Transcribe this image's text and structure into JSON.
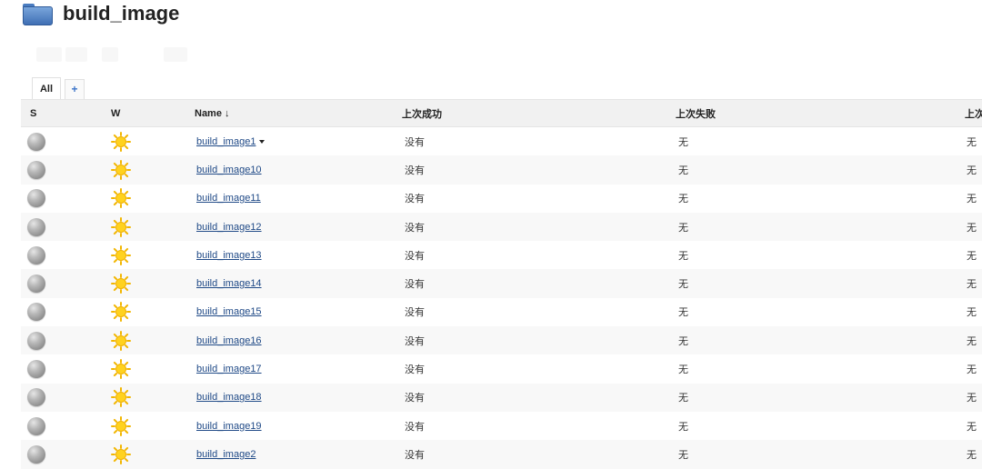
{
  "page": {
    "title": "build_image"
  },
  "tabs": {
    "all_label": "All",
    "add_label": "+"
  },
  "table": {
    "headers": {
      "status": "S",
      "weather": "W",
      "name": "Name ↓",
      "last_success": "上次成功",
      "last_failure": "上次失败",
      "last_duration": "上次持续时"
    },
    "rows": [
      {
        "name": "build_image1",
        "last_success": "没有",
        "last_failure": "无",
        "last_duration": "无"
      },
      {
        "name": "build_image10",
        "last_success": "没有",
        "last_failure": "无",
        "last_duration": "无"
      },
      {
        "name": "build_image11",
        "last_success": "没有",
        "last_failure": "无",
        "last_duration": "无"
      },
      {
        "name": "build_image12",
        "last_success": "没有",
        "last_failure": "无",
        "last_duration": "无"
      },
      {
        "name": "build_image13",
        "last_success": "没有",
        "last_failure": "无",
        "last_duration": "无"
      },
      {
        "name": "build_image14",
        "last_success": "没有",
        "last_failure": "无",
        "last_duration": "无"
      },
      {
        "name": "build_image15",
        "last_success": "没有",
        "last_failure": "无",
        "last_duration": "无"
      },
      {
        "name": "build_image16",
        "last_success": "没有",
        "last_failure": "无",
        "last_duration": "无"
      },
      {
        "name": "build_image17",
        "last_success": "没有",
        "last_failure": "无",
        "last_duration": "无"
      },
      {
        "name": "build_image18",
        "last_success": "没有",
        "last_failure": "无",
        "last_duration": "无"
      },
      {
        "name": "build_image19",
        "last_success": "没有",
        "last_failure": "无",
        "last_duration": "无"
      },
      {
        "name": "build_image2",
        "last_success": "没有",
        "last_failure": "无",
        "last_duration": "无"
      }
    ]
  },
  "icons": {
    "folder": "folder-icon",
    "status": "status-ball-icon",
    "weather": "sunny-weather-icon",
    "menu": "dropdown-icon"
  },
  "colors": {
    "link": "#204a87",
    "status_ball": "#a0a0a0",
    "sun": "#f5c400"
  }
}
